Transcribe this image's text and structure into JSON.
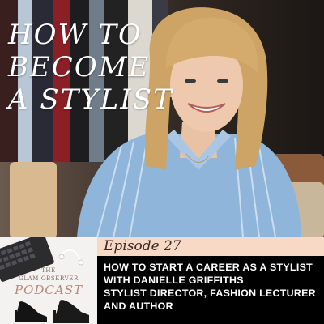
{
  "title": {
    "line1": "HOW TO",
    "line2": "BECOME",
    "line3": "A STYLIST"
  },
  "episode": {
    "label": "Episode 27"
  },
  "description": {
    "line1": "HOW TO START A CAREER AS A STYLIST",
    "line2": "WITH DANIELLE GRIFFITHS",
    "line3": "STYLIST DIRECTOR, FASHION LECTURER",
    "line4": "AND AUTHOR"
  },
  "logo": {
    "the": "THE",
    "brand": "GLAM OBSERVER",
    "podcast": "PODCAST"
  },
  "colors": {
    "episode_band": "#f7d9c6",
    "description_band": "#000000",
    "logo_background": "#f4f2f0",
    "podcast_accent": "#b48a7a"
  }
}
